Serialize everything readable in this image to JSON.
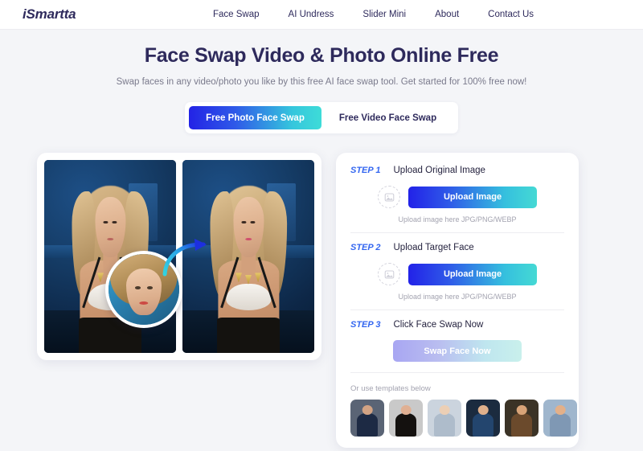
{
  "nav": {
    "logo": "iSmartta",
    "links": [
      {
        "label": "Face Swap"
      },
      {
        "label": "AI Undress"
      },
      {
        "label": "Slider Mini"
      },
      {
        "label": "About"
      },
      {
        "label": "Contact Us"
      }
    ]
  },
  "hero": {
    "title": "Face Swap Video & Photo Online Free",
    "subtitle": "Swap faces in any video/photo you like by this free AI face swap tool. Get started for 100% free now!"
  },
  "tabs": [
    {
      "label": "Free Photo Face Swap",
      "active": true
    },
    {
      "label": "Free Video Face Swap",
      "active": false
    }
  ],
  "demo": {
    "original_alt": "original-photo-blonde-woman",
    "result_alt": "result-photo-face-swapped",
    "face_bubble_alt": "source-face-circle-thumbnail",
    "arrow_alt": "swap-direction-arrow"
  },
  "steps": [
    {
      "number": "STEP 1",
      "label": "Upload Original Image",
      "button": "Upload Image",
      "hint": "Upload image here JPG/PNG/WEBP",
      "drop_icon": "image-placeholder-icon"
    },
    {
      "number": "STEP 2",
      "label": "Upload Target Face",
      "button": "Upload Image",
      "hint": "Upload image here JPG/PNG/WEBP",
      "drop_icon": "image-placeholder-icon"
    },
    {
      "number": "STEP 3",
      "label": "Click Face Swap Now",
      "button": "Swap Face Now"
    }
  ],
  "templates": {
    "title": "Or use templates below",
    "items": [
      {
        "name": "template-woman-navy-blazer",
        "bg": "#5a6475",
        "subj": "#1d2a44",
        "head": "#d2a384"
      },
      {
        "name": "template-woman-dark-hair",
        "bg": "#c9c9c9",
        "subj": "#14110f",
        "head": "#e0b093"
      },
      {
        "name": "template-woman-blonde-gown",
        "bg": "#cbd4de",
        "subj": "#aebccb",
        "head": "#eccfb5"
      },
      {
        "name": "template-man-superhero",
        "bg": "#1b2b3f",
        "subj": "#23456e",
        "head": "#dfb08c"
      },
      {
        "name": "template-woman-warrior",
        "bg": "#3b3326",
        "subj": "#6b4a2c",
        "head": "#d9a478"
      },
      {
        "name": "template-man-athlete",
        "bg": "#9fb6cd",
        "subj": "#7f98b4",
        "head": "#e3b089"
      }
    ]
  },
  "colors": {
    "brand_navy": "#2e2a5c",
    "accent_blue": "#3366f0",
    "gradient_start": "#2222e8",
    "gradient_end": "#45d9d4",
    "page_bg": "#f4f5f8"
  }
}
